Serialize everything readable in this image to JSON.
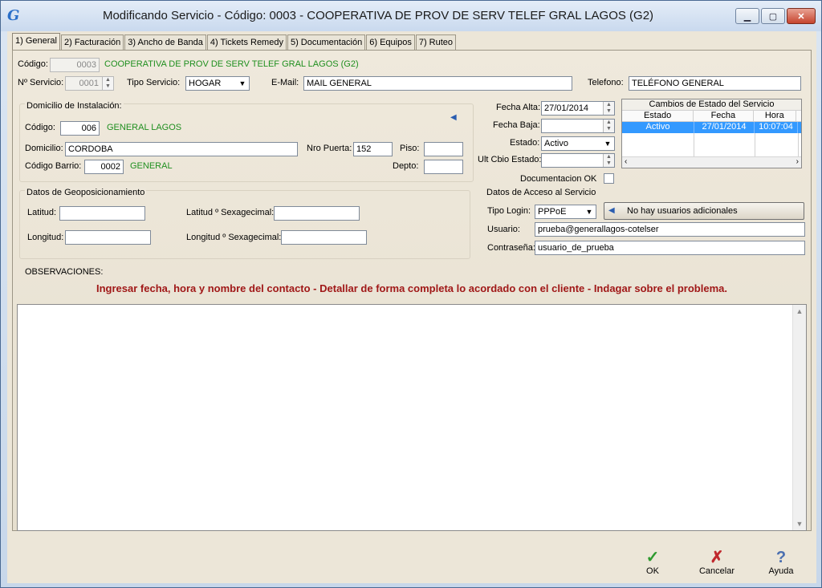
{
  "window": {
    "title": "Modificando Servicio - Código: 0003 - COOPERATIVA DE PROV DE SERV TELEF GRAL LAGOS (G2)",
    "app_icon": "G"
  },
  "tabs": [
    {
      "label": "1) General"
    },
    {
      "label": "2) Facturación"
    },
    {
      "label": "3) Ancho de Banda"
    },
    {
      "label": "4) Tickets Remedy"
    },
    {
      "label": "5) Documentación"
    },
    {
      "label": "6) Equipos"
    },
    {
      "label": "7) Ruteo"
    }
  ],
  "general": {
    "codigo_label": "Código:",
    "codigo_value": "0003",
    "codigo_name": "COOPERATIVA DE PROV DE SERV TELEF GRAL LAGOS (G2)",
    "nro_servicio_label": "Nº Servicio:",
    "nro_servicio_value": "0001",
    "tipo_servicio_label": "Tipo Servicio:",
    "tipo_servicio_value": "HOGAR",
    "email_label": "E-Mail:",
    "email_value": "MAIL GENERAL",
    "telefono_label": "Telefono:",
    "telefono_value": "TELÉFONO GENERAL"
  },
  "domicilio": {
    "section_label": "Domicilio de Instalación:",
    "codigo_label": "Código:",
    "codigo_value": "006",
    "codigo_name": "GENERAL LAGOS",
    "domicilio_label": "Domicilio:",
    "domicilio_value": "CORDOBA",
    "nro_puerta_label": "Nro Puerta:",
    "nro_puerta_value": "152",
    "piso_label": "Piso:",
    "piso_value": "",
    "barrio_label": "Código Barrio:",
    "barrio_value": "0002",
    "barrio_name": "GENERAL",
    "depto_label": "Depto:",
    "depto_value": ""
  },
  "estado": {
    "fecha_alta_label": "Fecha Alta:",
    "fecha_alta_value": "27/01/2014",
    "fecha_baja_label": "Fecha Baja:",
    "fecha_baja_value": "",
    "estado_label": "Estado:",
    "estado_value": "Activo",
    "ult_cbio_label": "Ult Cbio Estado:",
    "ult_cbio_value": "",
    "doc_ok_label": "Documentacion OK",
    "doc_ok_checked": false,
    "cambios": {
      "title": "Cambios de Estado del Servicio",
      "columns": [
        "Estado",
        "Fecha",
        "Hora"
      ],
      "rows": [
        [
          "Activo",
          "27/01/2014",
          "10:07:04"
        ]
      ]
    }
  },
  "geo": {
    "section_label": "Datos de Geoposicionamiento",
    "latitud_label": "Latitud:",
    "latitud_value": "",
    "latitud_sex_label": "Latitud º Sexagecimal:",
    "latitud_sex_value": "",
    "longitud_label": "Longitud:",
    "longitud_value": "",
    "longitud_sex_label": "Longitud º Sexagecimal:",
    "longitud_sex_value": ""
  },
  "acceso": {
    "section_label": "Datos de Acceso al Servicio",
    "tipo_login_label": "Tipo Login:",
    "tipo_login_value": "PPPoE",
    "usuarios_button": "No hay usuarios adicionales",
    "usuario_label": "Usuario:",
    "usuario_value": "prueba@generallagos-cotelser",
    "contrasena_label": "Contraseña:",
    "contrasena_value": "usuario_de_prueba"
  },
  "observaciones": {
    "label": "OBSERVACIONES:",
    "hint": "Ingresar fecha, hora y nombre del contacto - Detallar de forma completa lo acordado con el cliente - Indagar sobre el problema.",
    "text": "",
    "hint_color": "#a01818"
  },
  "footer": {
    "ok_label": "OK",
    "cancel_label": "Cancelar",
    "help_label": "Ayuda"
  },
  "colors": {
    "green_text": "#1f8f1f",
    "selection": "#3399ff",
    "ok_icon": "#2e9a2e",
    "cancel_icon": "#c0282d",
    "help_icon": "#4a6fb0"
  }
}
